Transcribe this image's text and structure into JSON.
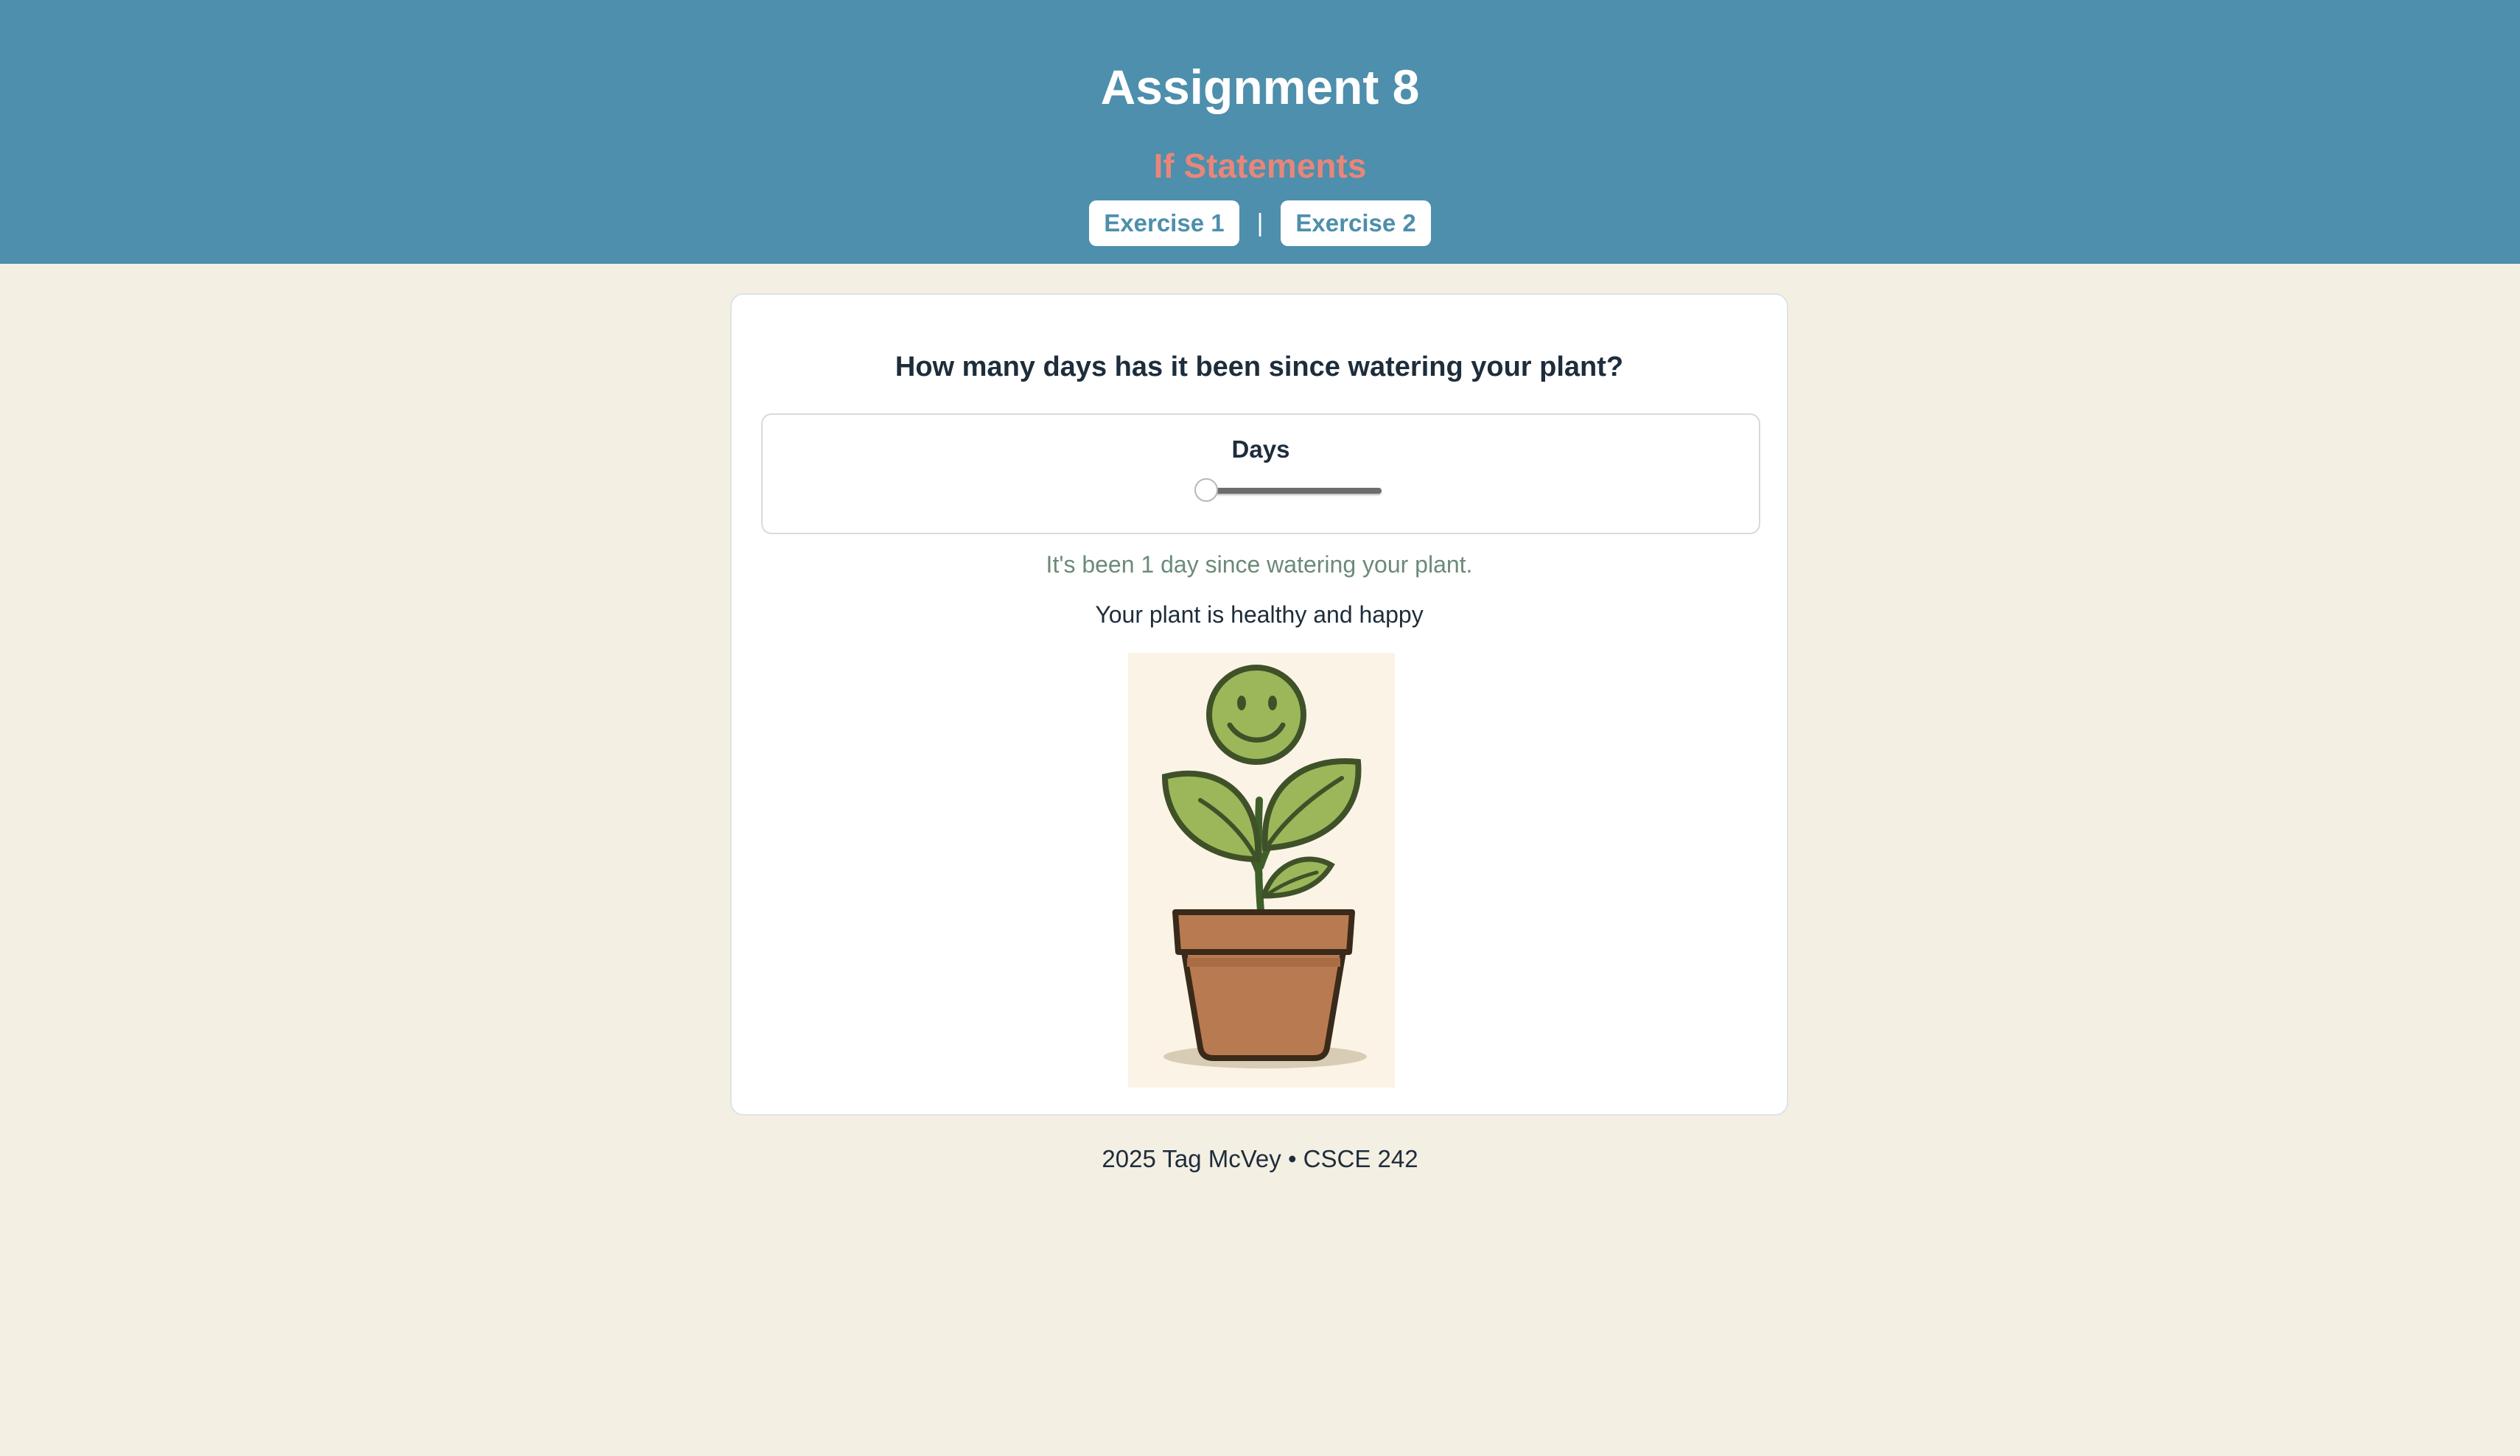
{
  "header": {
    "title": "Assignment 8",
    "subtitle": "If Statements",
    "nav": [
      {
        "label": "Exercise 1"
      },
      {
        "label": "Exercise 2"
      }
    ],
    "separator": "|"
  },
  "card": {
    "question": "How many days has it been since watering your plant?",
    "slider": {
      "label": "Days",
      "value": 1,
      "position_fraction": 0.0
    },
    "days_message": "It's been 1 day since watering your plant.",
    "health_message": "Your plant is healthy and happy",
    "image": {
      "icon": "happy-plant-illustration"
    }
  },
  "footer": {
    "text": "2025 Tag McVey • CSCE 242"
  },
  "colors": {
    "header_bg": "#4d8fac",
    "subtitle": "#e8867a",
    "page_bg": "#f4efe3",
    "days_message": "#6b8a78"
  }
}
